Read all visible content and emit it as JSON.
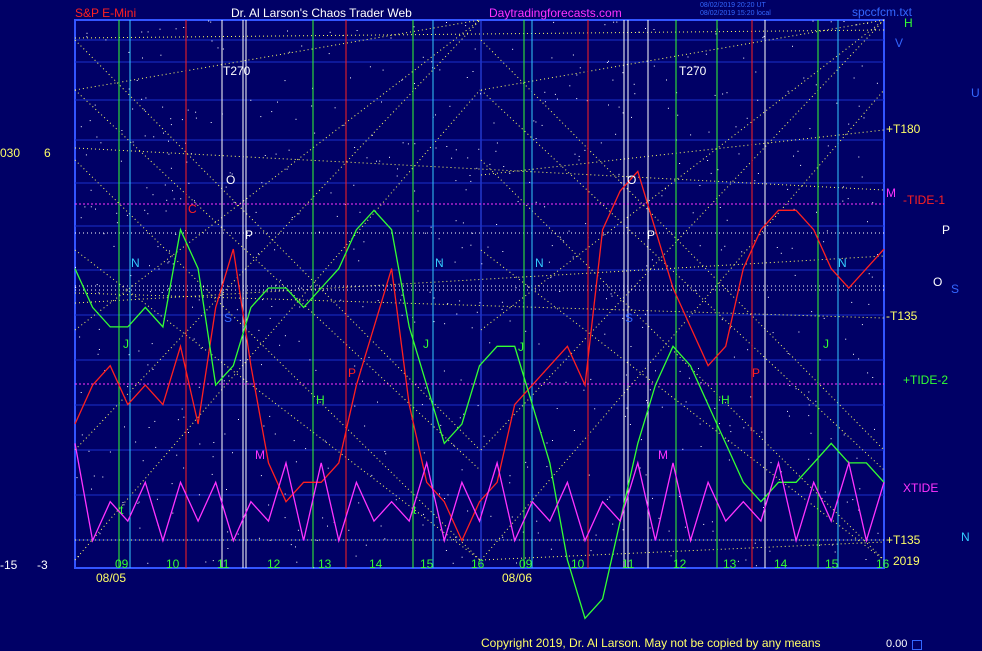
{
  "header": {
    "symbol": "S&P E-Mini",
    "title": "Dr. Al Larson's Chaos Trader Web",
    "site": "Daytradingforecasts.com",
    "stamp_line1": "08/02/2019 20:20 UT",
    "stamp_line2": "08/02/2019 15:20 local",
    "file": "spccfcm.txt"
  },
  "left_axis": {
    "top_labels": [
      "030",
      "6"
    ],
    "bottom_labels": [
      "-15",
      "-3"
    ]
  },
  "right_labels": {
    "h": "H",
    "v": "V",
    "u": "U",
    "t180": "+T180",
    "m": "M",
    "tide1": "-TIDE-1",
    "p": "P",
    "o": "O",
    "s": "S",
    "t135neg": "-T135",
    "tide2": "+TIDE-2",
    "xtide": "XTIDE",
    "t135pos": "+T135",
    "n": "N",
    "year": "2019"
  },
  "days": [
    {
      "date": "08/05",
      "hours": [
        "09",
        "10",
        "11",
        "12",
        "13",
        "14",
        "15",
        "16"
      ]
    },
    {
      "date": "08/06",
      "hours": [
        "09",
        "10",
        "11",
        "12",
        "13",
        "14",
        "15",
        "16"
      ]
    }
  ],
  "markers": {
    "t270": "T270",
    "n": "N",
    "c": "C",
    "o": "O",
    "p": "P",
    "s": "S",
    "j": "J",
    "h": "H",
    "m": "M",
    "t": "t",
    "pr": "P"
  },
  "footer": {
    "copyright": "Copyright 2019, Dr. Al Larson. May not be copied by any means",
    "value": "0.00"
  },
  "colors": {
    "background": "#000066",
    "frame": "#3355ff",
    "red_line": "#ff2020",
    "green_line": "#33ff33",
    "magenta_line": "#ff33ff",
    "yellow_dots": "#ffff66",
    "cyan_line": "#33ccff"
  },
  "chart_data": {
    "type": "line",
    "x_ticks": [
      "09",
      "10",
      "11",
      "12",
      "13",
      "14",
      "15",
      "16",
      "09",
      "10",
      "11",
      "12",
      "13",
      "14",
      "15",
      "16"
    ],
    "series": [
      {
        "name": "-TIDE-1",
        "color": "#ff2020",
        "values": [
          -8,
          -6,
          -5,
          -7,
          -6,
          -7,
          -4,
          -8,
          -2,
          1,
          -5,
          -10,
          -12,
          -11,
          -11,
          -10,
          -6,
          -3,
          0,
          -7,
          -11,
          -12,
          -14,
          -12,
          -11,
          -7,
          -6,
          -5,
          -4,
          -6,
          2,
          4,
          5,
          2,
          -1,
          -3,
          -5,
          -4,
          0,
          2,
          3,
          3,
          2,
          0,
          -1,
          0,
          1
        ]
      },
      {
        "name": "+TIDE-2",
        "color": "#33ff33",
        "values": [
          0,
          -2,
          -3,
          -3,
          -2,
          -3,
          2,
          0,
          -6,
          -5,
          -2,
          -1,
          -1,
          -2,
          -1,
          0,
          2,
          3,
          2,
          -3,
          -6,
          -9,
          -8,
          -5,
          -4,
          -4,
          -7,
          -10,
          -15,
          -18,
          -17,
          -13,
          -9,
          -6,
          -4,
          -5,
          -7,
          -9,
          -11,
          -12,
          -11,
          -11,
          -10,
          -9,
          -10,
          -10,
          -11
        ]
      },
      {
        "name": "XTIDE",
        "color": "#ff33ff",
        "values": [
          -9,
          -14,
          -12,
          -13,
          -11,
          -14,
          -11,
          -13,
          -11,
          -14,
          -12,
          -13,
          -10,
          -14,
          -10,
          -14,
          -11,
          -13,
          -12,
          -13,
          -10,
          -14,
          -11,
          -13,
          -10,
          -14,
          -12,
          -13,
          -11,
          -14,
          -12,
          -13,
          -10,
          -14,
          -10,
          -14,
          -11,
          -13,
          -12,
          -13,
          -10,
          -14,
          -11,
          -13,
          -10,
          -14,
          -11
        ]
      }
    ],
    "horizontal_levels": [
      {
        "name": "-TIDE-1",
        "color": "#ff33ff"
      },
      {
        "name": "+TIDE-2",
        "color": "#ff33ff"
      }
    ]
  }
}
